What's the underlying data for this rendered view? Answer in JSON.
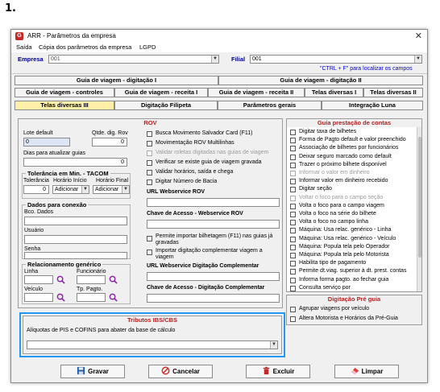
{
  "step_label": "1.",
  "window": {
    "title": "ARR - Parâmetros da empresa",
    "close_glyph": "✕",
    "app_icon_letter": "G"
  },
  "menu": [
    "Saída",
    "Cópia dos parâmetros da empresa",
    "LGPD"
  ],
  "filter": {
    "empresa_label": "Empresa",
    "empresa_value": "001",
    "filial_label": "Filial",
    "filial_value": "001",
    "hint": "\"CTRL + F\" para localizar os campos"
  },
  "tabs_row1": [
    "Guia de viagem - digitação I",
    "Guia de viagem - digitação II"
  ],
  "tabs_row2": [
    "Guia de viagem - controles",
    "Guia de viagem - receita I",
    "Guia de viagem - receita II",
    "Telas diversas I",
    "Telas diversas II"
  ],
  "tabs_row3": [
    "Telas diversas III",
    "Digitação Filipeta",
    "Parâmetros gerais",
    "Integração Luna"
  ],
  "rov": {
    "title": "ROV",
    "lote_default_label": "Lote default",
    "lote_default_value": "0",
    "qtde_rov_label": "Qtde. dig. Rov",
    "qtde_rov_value": "0",
    "dias_label": "Dias para atualizar guias",
    "dias_value": "0",
    "tolerancia": {
      "title": "Tolerância em Min. - TACOM",
      "col1": "Tolerância",
      "col2": "Horário Início",
      "col3": "Horário Final",
      "value": "0",
      "inicio": "Adicionar",
      "final": "Adicionar"
    },
    "conexao": {
      "title": "Dados para conexão",
      "bco": "Bco. Dados",
      "usuario": "Usuário",
      "senha": "Senha"
    },
    "relacionamento": {
      "title": "Relacionamento genérico",
      "linha": "Linha",
      "funcionario": "Funcionário",
      "veiculo": "Veículo",
      "tp_pagto": "Tp. Pagto."
    },
    "checks": [
      {
        "label": "Busca Movimento Salvador Card (F11)",
        "enabled": true
      },
      {
        "label": "Movimentação ROV Multilinhas",
        "enabled": true
      },
      {
        "label": "Validar roletas digitadas nas guias de viagem",
        "enabled": false
      },
      {
        "label": "Verificar se existe guia de viagem gravada",
        "enabled": true
      },
      {
        "label": "Validar horários, saída e chega",
        "enabled": true
      },
      {
        "label": "Digitar Número de Bacia",
        "enabled": true
      }
    ],
    "url_webservice_label": "URL Webservice ROV",
    "chave_webservice_label": "Chave de Acesso - Webservice ROV",
    "check_bilhetagem": "Permite importar bilhetagem (F11) nas guias já gravadas",
    "check_importar": "Importar digitação complementar viagem a viagem",
    "url_complementar_label": "URL Webservice Digitação Complementar",
    "chave_complementar_label": "Chave de Acesso - Digitação Complementar"
  },
  "prestacao": {
    "title": "Guia prestação de contas",
    "items": [
      {
        "label": "Digitar taxa de bilhetes",
        "enabled": true
      },
      {
        "label": "Forma de Pagto default e valor preenchido",
        "enabled": true
      },
      {
        "label": "Associação de bilhetes por funcionários",
        "enabled": true
      },
      {
        "label": "Deixar seguro marcado como default",
        "enabled": true
      },
      {
        "label": "Trazer o próximo bilhete disponível",
        "enabled": true
      },
      {
        "label": "Informar o valor em dinheiro",
        "enabled": false
      },
      {
        "label": "Informar valor em dinheiro recebido",
        "enabled": true
      },
      {
        "label": "Digitar seção",
        "enabled": true
      },
      {
        "label": "Voltar o foco para o campo seção",
        "enabled": false
      },
      {
        "label": "Volta o foco para o campo viagem",
        "enabled": true
      },
      {
        "label": "Volta o foco na série do bilhete",
        "enabled": true
      },
      {
        "label": "Volta o foco no campo linha",
        "enabled": true
      },
      {
        "label": "Máquina: Usa relac. genérico - Linha",
        "enabled": true
      },
      {
        "label": "Máquina: Usa relac. genérico - Veículo",
        "enabled": true
      },
      {
        "label": "Máquina: Popula tela pelo Operador",
        "enabled": true
      },
      {
        "label": "Máquina: Popula tela pelo Motorista",
        "enabled": true
      },
      {
        "label": "Habilita tipo de pagamento",
        "enabled": true
      },
      {
        "label": "Permite dt.viag. superior à dt. prest. contas",
        "enabled": true
      },
      {
        "label": "Informa forma pagto. ao fechar guia",
        "enabled": true
      },
      {
        "label": "Consulta serviço por",
        "enabled": true
      }
    ]
  },
  "pre_guia": {
    "title": "Digitação Pré guia",
    "items": [
      "Agrupar viagens por veículo",
      "Altera Motorista e Horários da Pré-Guia"
    ]
  },
  "tributos": {
    "title": "Tributos IBS/CBS",
    "label": "Alíquotas de PIS e COFINS para abater da base de cálculo",
    "value": ""
  },
  "buttons": {
    "gravar": "Gravar",
    "cancelar": "Cancelar",
    "excluir": "Excluir",
    "limpar": "Limpar"
  },
  "colors": {
    "accent_red": "#b22222",
    "active_tab": "#ffefa8",
    "highlight_blue": "#2196f3",
    "label_blue": "#00008b"
  }
}
